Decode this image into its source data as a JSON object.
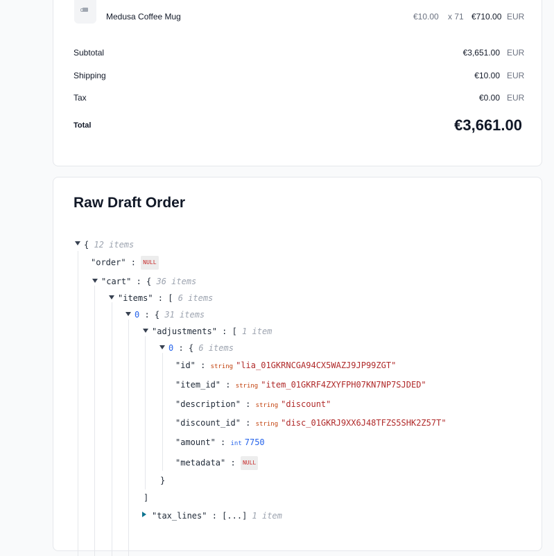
{
  "line_item": {
    "name": "Medusa Coffee Mug",
    "unit_price": "€10.00",
    "quantity": "x 71",
    "line_total": "€710.00",
    "currency": "EUR",
    "thumbnail_icon": "mug-icon"
  },
  "summary": {
    "subtotal_label": "Subtotal",
    "subtotal_value": "€3,651.00",
    "shipping_label": "Shipping",
    "shipping_value": "€10.00",
    "tax_label": "Tax",
    "tax_value": "€0.00",
    "total_label": "Total",
    "total_value": "€3,661.00",
    "currency": "EUR"
  },
  "raw": {
    "title": "Raw Draft Order",
    "root_count": "12 items",
    "order_key": "\"order\"",
    "null_label": "NULL",
    "cart_key": "\"cart\"",
    "cart_count": "36 items",
    "items_key": "\"items\"",
    "items_count": "6 items",
    "item0_index": "0",
    "item0_count": "31 items",
    "adjustments_key": "\"adjustments\"",
    "adjustments_count": "1 item",
    "adj0_index": "0",
    "adj0_count": "6 items",
    "fields": {
      "id_key": "\"id\"",
      "id_type": "string",
      "id_value": "\"lia_01GKRNCGA94CX5WAZJ9JP99ZGT\"",
      "item_id_key": "\"item_id\"",
      "item_id_type": "string",
      "item_id_value": "\"item_01GKRF4ZXYFPH07KN7NP7SJDED\"",
      "description_key": "\"description\"",
      "description_type": "string",
      "description_value": "\"discount\"",
      "discount_id_key": "\"discount_id\"",
      "discount_id_type": "string",
      "discount_id_value": "\"disc_01GKRJ9XX6J48TFZS5SHK2Z57T\"",
      "amount_key": "\"amount\"",
      "amount_type": "int",
      "amount_value": "7750",
      "metadata_key": "\"metadata\""
    },
    "tax_lines_key": "\"tax_lines\"",
    "tax_lines_collapsed": "[...]",
    "tax_lines_count": "1 item"
  }
}
